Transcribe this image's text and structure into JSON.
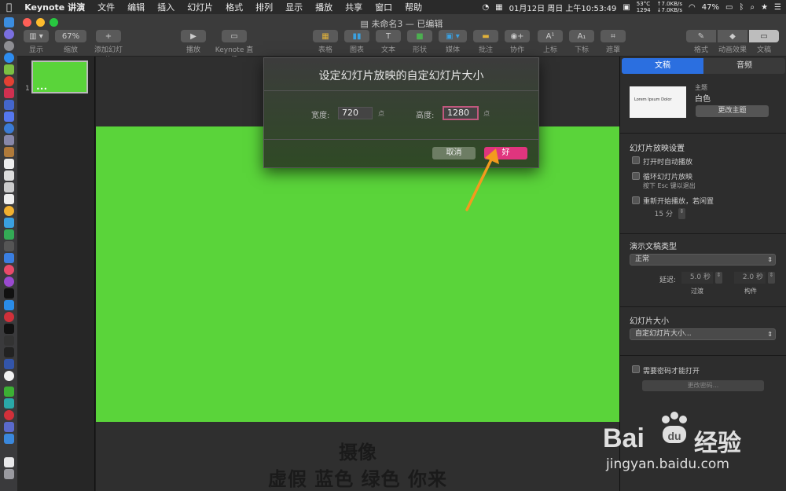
{
  "menubar": {
    "items": [
      "Keynote 讲演",
      "文件",
      "编辑",
      "插入",
      "幻灯片",
      "格式",
      "排列",
      "显示",
      "播放",
      "共享",
      "窗口",
      "帮助"
    ],
    "datetime": "01月12日 周日 上午10:53:49",
    "temp": "53°C",
    "fan": "1294",
    "net_up": "↑7.0KB/s",
    "net_down": "↓7.0KB/s",
    "battery": "47%"
  },
  "window": {
    "title": "未命名3 — 已编辑"
  },
  "toolbar": {
    "view": "显示",
    "zoom_value": "67%",
    "zoom": "缩放",
    "add_slide": "添加幻灯片",
    "play": "播放",
    "live": "Keynote 直播",
    "table": "表格",
    "chart": "图表",
    "text": "文本",
    "shape": "形状",
    "media": "媒体",
    "comment": "批注",
    "collaborate": "协作",
    "superscript": "上标",
    "subscript": "下标",
    "mask": "遮罩",
    "format": "格式",
    "animate": "动画效果",
    "document": "文稿"
  },
  "navigator": {
    "slide_number": "1"
  },
  "canvas": {
    "caption_line1": "摄像",
    "caption_line2": "虚假 蓝色 绿色 你来"
  },
  "dialog": {
    "title": "设定幻灯片放映的自定幻灯片大小",
    "width_label": "宽度:",
    "width_value": "720",
    "height_label": "高度:",
    "height_value": "1280",
    "unit": "点",
    "cancel": "取消",
    "ok": "好"
  },
  "inspector": {
    "tab_document": "文稿",
    "tab_audio": "音频",
    "theme_label": "主题",
    "theme_name": "白色",
    "theme_preview_text": "Lorem Ipsum Dolor",
    "change_theme": "更改主题",
    "slideshow_settings": "幻灯片放映设置",
    "autoplay": "打开时自动播放",
    "loop": "循环幻灯片放映",
    "loop_hint": "按下 Esc 键以退出",
    "restart_idle": "重新开始播放，若闲置",
    "idle_minutes": "15 分",
    "presentation_type": "演示文稿类型",
    "presentation_type_value": "正常",
    "delay_label": "延迟:",
    "transition_delay": "5.0 秒",
    "build_delay": "2.0 秒",
    "transition_label": "过渡",
    "build_label": "构件",
    "slide_size": "幻灯片大小",
    "slide_size_value": "自定幻灯片大小...",
    "require_password": "需要密码才能打开",
    "change_password": "更改密码..."
  },
  "watermark": {
    "brand": "Bai",
    "brand_cn": "经验",
    "url": "jingyan.baidu.com"
  }
}
